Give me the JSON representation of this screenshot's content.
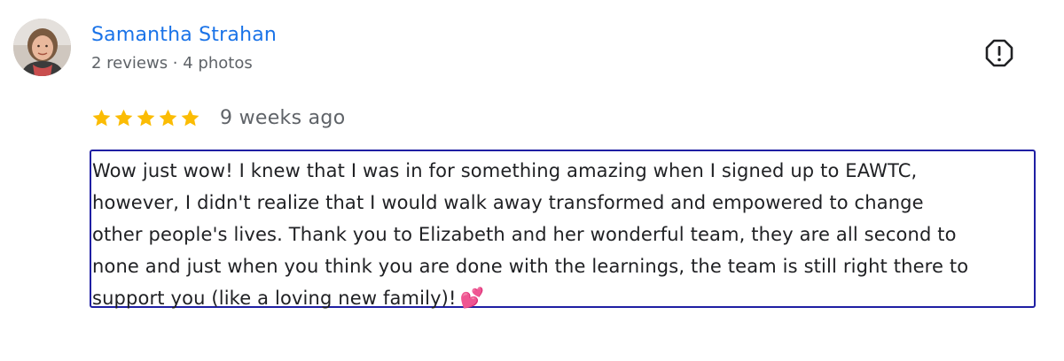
{
  "author": {
    "name": "Samantha Strahan",
    "meta": "2 reviews · 4 photos"
  },
  "review": {
    "rating": 5,
    "max_rating": 5,
    "date": "9 weeks ago",
    "lines": [
      "Wow just wow! I knew that I was in for something amazing when I signed up to EAWTC,",
      "however, I didn't realize that I would walk away transformed and empowered to change",
      "other people's lives. Thank you to Elizabeth and her wonderful team, they are all second to",
      "none and just when you think you are done with the learnings, the team is still right there to",
      "support you (like a loving new family)!"
    ],
    "emoji": "💕"
  },
  "colors": {
    "name": "#1a73e8",
    "star": "#fbbc04",
    "highlight_border": "#1f1fa3",
    "muted": "#5f6368"
  },
  "icons": {
    "flag": "report-flag-icon",
    "star": "star-icon"
  }
}
